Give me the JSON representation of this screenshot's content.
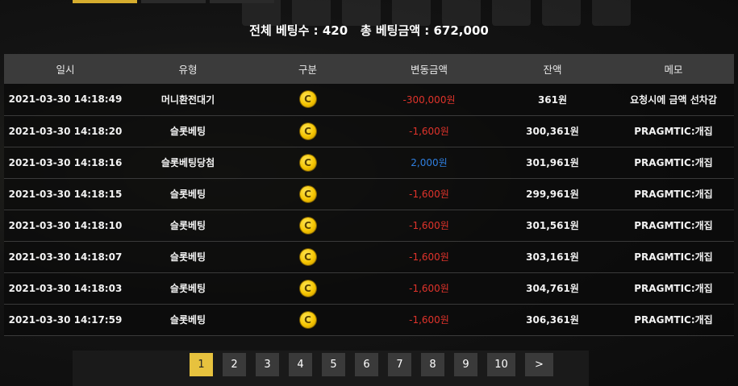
{
  "summary": {
    "total_bets_label": "전체 베팅수 : ",
    "total_bets_value": "420",
    "total_amount_label": "총 베팅금액 : ",
    "total_amount_value": "672,000"
  },
  "columns": [
    "일시",
    "유형",
    "구분",
    "변동금액",
    "잔액",
    "메모"
  ],
  "rows": [
    {
      "date": "2021-03-30 14:18:49",
      "type": "머니환전대기",
      "coin": "C",
      "amount": "-300,000원",
      "sign": "neg",
      "balance": "361원",
      "memo": "요청시에 금액 선차감"
    },
    {
      "date": "2021-03-30 14:18:20",
      "type": "슬롯베팅",
      "coin": "C",
      "amount": "-1,600원",
      "sign": "neg",
      "balance": "300,361원",
      "memo": "PRAGMTIC:개집"
    },
    {
      "date": "2021-03-30 14:18:16",
      "type": "슬롯베팅당첨",
      "coin": "C",
      "amount": "2,000원",
      "sign": "pos",
      "balance": "301,961원",
      "memo": "PRAGMTIC:개집"
    },
    {
      "date": "2021-03-30 14:18:15",
      "type": "슬롯베팅",
      "coin": "C",
      "amount": "-1,600원",
      "sign": "neg",
      "balance": "299,961원",
      "memo": "PRAGMTIC:개집"
    },
    {
      "date": "2021-03-30 14:18:10",
      "type": "슬롯베팅",
      "coin": "C",
      "amount": "-1,600원",
      "sign": "neg",
      "balance": "301,561원",
      "memo": "PRAGMTIC:개집"
    },
    {
      "date": "2021-03-30 14:18:07",
      "type": "슬롯베팅",
      "coin": "C",
      "amount": "-1,600원",
      "sign": "neg",
      "balance": "303,161원",
      "memo": "PRAGMTIC:개집"
    },
    {
      "date": "2021-03-30 14:18:03",
      "type": "슬롯베팅",
      "coin": "C",
      "amount": "-1,600원",
      "sign": "neg",
      "balance": "304,761원",
      "memo": "PRAGMTIC:개집"
    },
    {
      "date": "2021-03-30 14:17:59",
      "type": "슬롯베팅",
      "coin": "C",
      "amount": "-1,600원",
      "sign": "neg",
      "balance": "306,361원",
      "memo": "PRAGMTIC:개집"
    }
  ],
  "pagination": {
    "pages": [
      "1",
      "2",
      "3",
      "4",
      "5",
      "6",
      "7",
      "8",
      "9",
      "10"
    ],
    "current": "1",
    "next_label": ">"
  },
  "colors": {
    "accent": "#e7c23e",
    "negative": "#e0332b",
    "positive": "#2f7fe0",
    "header_bg": "#3b3b3b"
  },
  "icons": {
    "coin": "coin-icon"
  }
}
